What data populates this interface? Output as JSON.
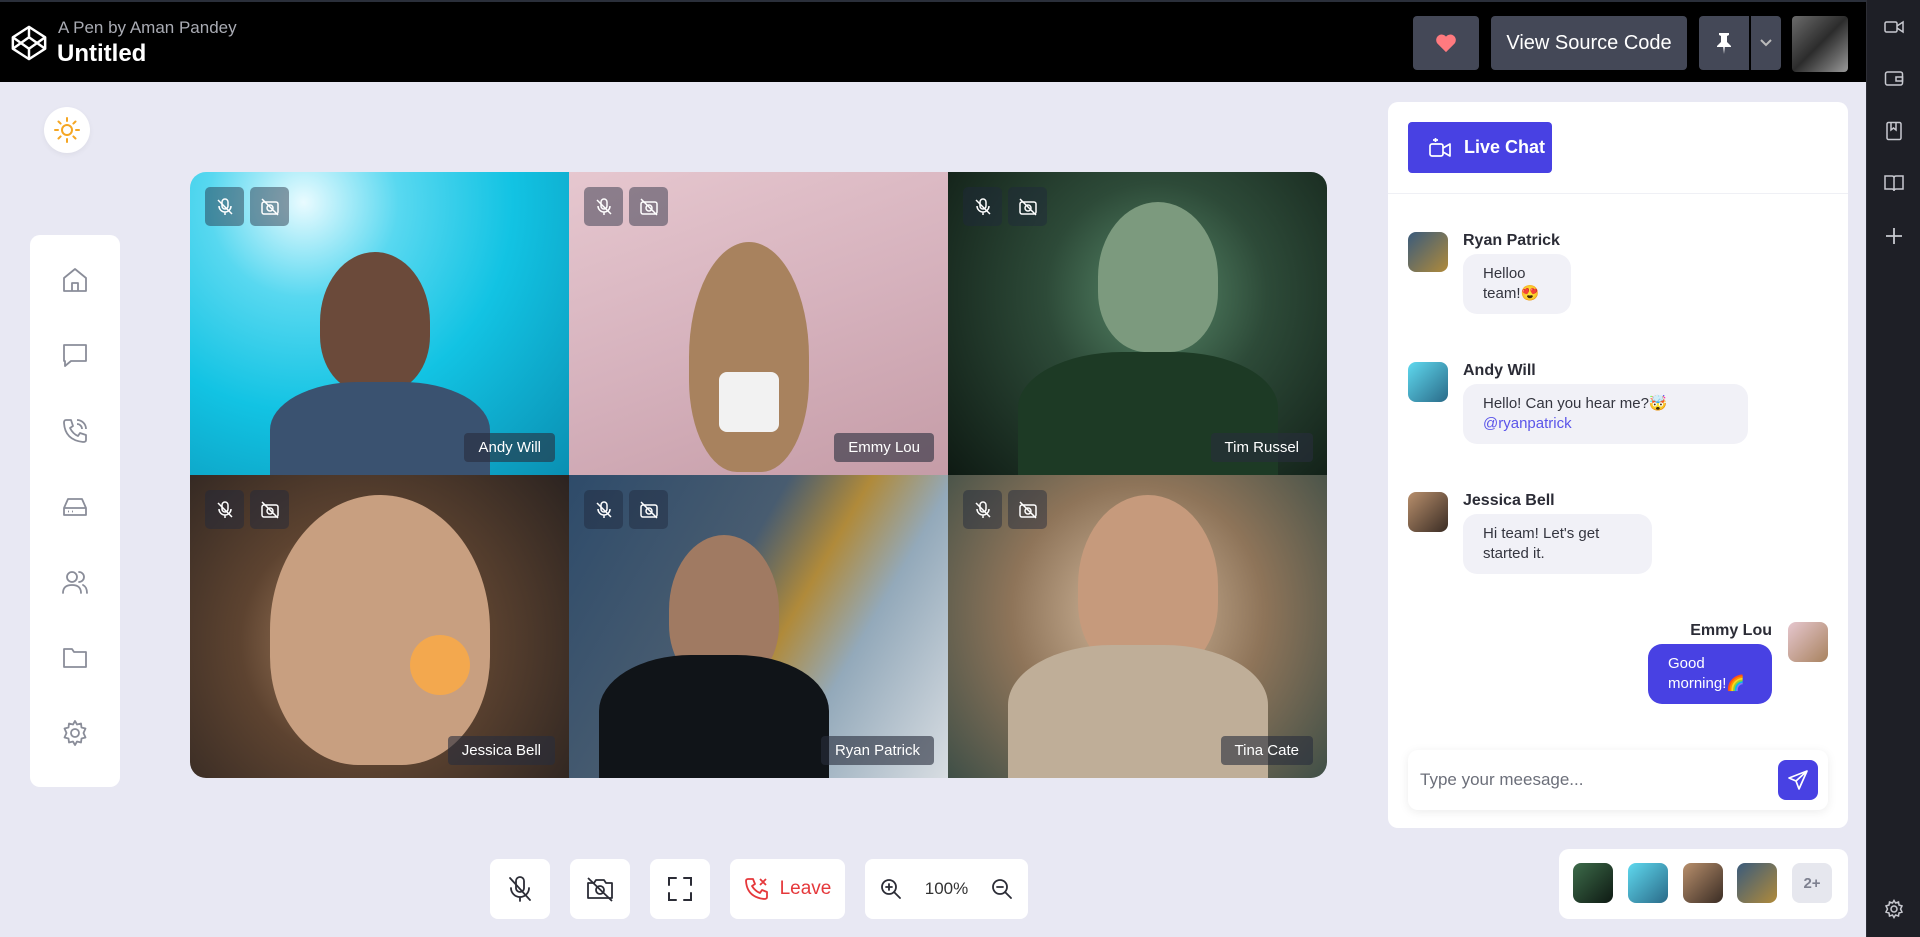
{
  "topbar": {
    "pen_by": "A Pen by Aman Pandey",
    "title": "Untitled",
    "view_source_label": "View Source Code"
  },
  "sidebar": {
    "items": [
      {
        "icon": "home-icon"
      },
      {
        "icon": "chat-icon"
      },
      {
        "icon": "phone-icon"
      },
      {
        "icon": "drive-icon"
      },
      {
        "icon": "users-icon"
      },
      {
        "icon": "folder-icon"
      },
      {
        "icon": "settings-icon"
      }
    ]
  },
  "video_grid": {
    "participants": [
      {
        "name": "Andy Will"
      },
      {
        "name": "Emmy Lou"
      },
      {
        "name": "Tim Russel"
      },
      {
        "name": "Jessica Bell"
      },
      {
        "name": "Ryan Patrick"
      },
      {
        "name": "Tina Cate"
      }
    ]
  },
  "controls": {
    "leave_label": "Leave",
    "zoom_level": "100%"
  },
  "participants_strip": {
    "more_label": "2+"
  },
  "chat": {
    "tab_label": "Live Chat",
    "messages": [
      {
        "author": "Ryan Patrick",
        "text": "Helloo team!😍",
        "mention": "",
        "side": "left"
      },
      {
        "author": "Andy Will",
        "text": "Hello! Can you hear me?🤯",
        "mention": "@ryanpatrick",
        "side": "left"
      },
      {
        "author": "Jessica Bell",
        "text": "Hi team! Let's get started it.",
        "mention": "",
        "side": "left"
      },
      {
        "author": "Emmy Lou",
        "text": "Good morning!🌈",
        "mention": "",
        "side": "right"
      }
    ],
    "input_placeholder": "Type your meesage..."
  },
  "colors": {
    "accent": "#4841e3",
    "leave": "#e5383b",
    "background": "#e8e8f3",
    "topbar": "#000000"
  }
}
